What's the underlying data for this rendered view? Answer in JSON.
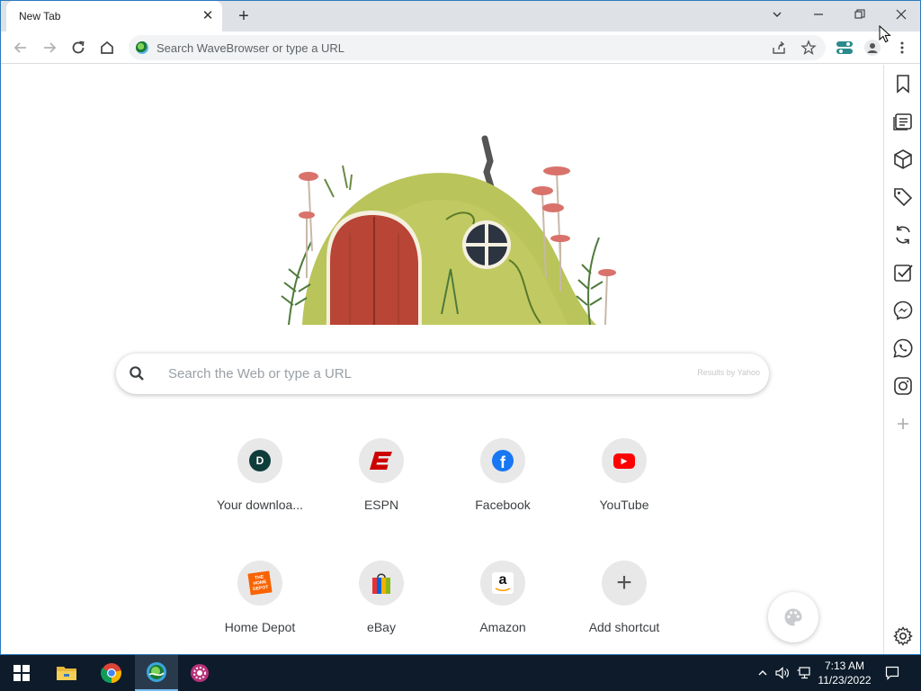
{
  "tab": {
    "title": "New Tab",
    "close": "✕",
    "new_tab": "+"
  },
  "window_controls": {
    "dropdown": "⌄",
    "minimize": "—",
    "close": "✕"
  },
  "omnibox": {
    "placeholder": "Search WaveBrowser or type a URL"
  },
  "search": {
    "placeholder": "Search the Web or type a URL",
    "credit": "Results by Yahoo"
  },
  "shortcuts": [
    {
      "label": "Your downloa...",
      "icon": "d-icon",
      "glyph": "D"
    },
    {
      "label": "ESPN",
      "icon": "espn-icon",
      "glyph": "E"
    },
    {
      "label": "Facebook",
      "icon": "facebook-icon",
      "glyph": "f"
    },
    {
      "label": "YouTube",
      "icon": "youtube-icon",
      "glyph": "▶"
    },
    {
      "label": "Home Depot",
      "icon": "home-depot-icon",
      "glyph": "THE HOME DEPOT"
    },
    {
      "label": "eBay",
      "icon": "ebay-icon",
      "glyph": ""
    },
    {
      "label": "Amazon",
      "icon": "amazon-icon",
      "glyph": "a"
    },
    {
      "label": "Add shortcut",
      "icon": "plus-icon",
      "glyph": "+"
    }
  ],
  "sidebar_icons": [
    "bookmark-icon",
    "reading-list-icon",
    "box-icon",
    "tag-icon",
    "sync-icon",
    "checklist-icon",
    "messenger-icon",
    "whatsapp-icon",
    "instagram-icon",
    "add-icon",
    "settings-icon"
  ],
  "clock": {
    "time": "7:13 AM",
    "date": "11/23/2022"
  },
  "colors": {
    "espn_red": "#cc0000",
    "facebook_blue": "#1877f2",
    "youtube_red": "#ff0000",
    "home_depot_orange": "#f96302",
    "taskbar": "#0d1b2a"
  }
}
